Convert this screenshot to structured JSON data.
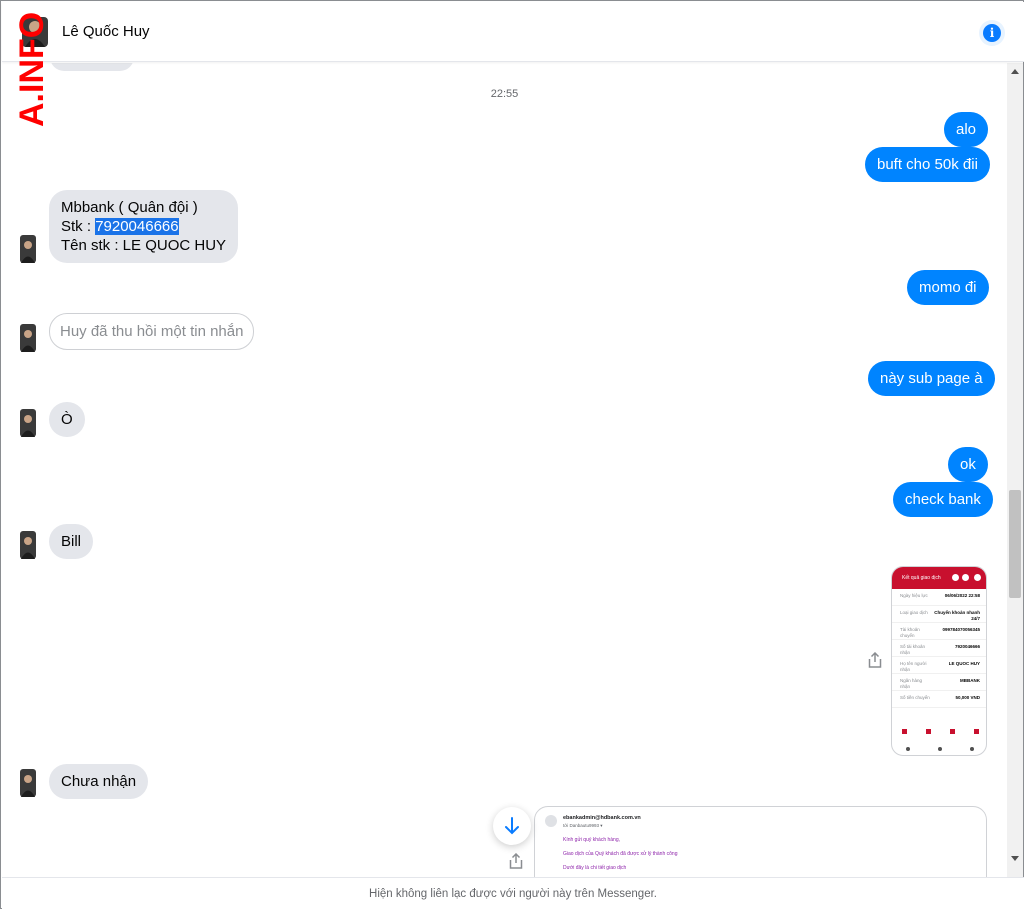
{
  "header": {
    "contact_name": "Lê Quốc Huy",
    "info_icon": "info-icon"
  },
  "watermark": "A.INFO",
  "timestamp": "22:55",
  "messages": {
    "m_alo": "alo",
    "m_buft": "buft cho 50k đii",
    "m_bank_line1": "Mbbank ( Quân đội )",
    "m_bank_line2_prefix": "Stk : ",
    "m_bank_line2_number": "7920046666",
    "m_bank_line3": "Tên stk : LE QUOC HUY",
    "m_momo": "momo đi",
    "m_unsent": "Huy đã thu hồi một tin nhắn",
    "m_sub": "này sub page à",
    "m_o": "Ò",
    "m_ok": "ok",
    "m_check": "check bank",
    "m_bill": "Bill",
    "m_chua": "Chưa nhận"
  },
  "receipt": {
    "title": "Kết quả giao dịch",
    "rows": [
      {
        "k": "Ngày hiệu lực",
        "v": "06/06/2022 22:58"
      },
      {
        "k": "Loại giao dịch",
        "v": "Chuyển khoản nhanh 24/7"
      },
      {
        "k": "Tài khoản chuyển",
        "v": "099784070056345"
      },
      {
        "k": "Số tài khoản nhận",
        "v": "7920046666"
      },
      {
        "k": "Họ tên người nhận",
        "v": "LE QUOC HUY"
      },
      {
        "k": "Ngân hàng nhận",
        "v": "MBBANK"
      },
      {
        "k": "Số tiền chuyển",
        "v": "50,000 VND"
      }
    ]
  },
  "email": {
    "from": "ebankadmin@hdbank.com.vn",
    "to": "tới Danbautu9993 ▾",
    "line1": "Kính gửi quý khách hàng,",
    "line2": "Giao dịch của Quý khách đã được xử lý thành công",
    "line3": "Dưới đây là chi tiết giao dịch"
  },
  "footer": {
    "notice": "Hiện không liên lạc được với người này trên Messenger."
  },
  "colors": {
    "outgoing": "#0084ff",
    "incoming": "#e4e6eb",
    "accent": "#0a7cff",
    "watermark": "#ff0000"
  }
}
